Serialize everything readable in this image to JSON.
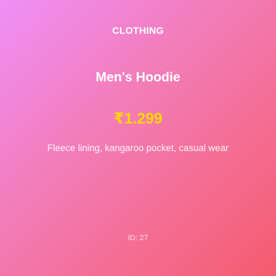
{
  "product": {
    "category": "CLOTHING",
    "name": "Men's Hoodie",
    "price": "₹1.299",
    "description": "Fleece lining, kangaroo pocket, casual wear",
    "id_label": "ID: 27"
  },
  "colors": {
    "price": "#ffd700",
    "text": "#ffffff",
    "gradient_start": "#f08ff8",
    "gradient_end": "#f55b6d"
  }
}
